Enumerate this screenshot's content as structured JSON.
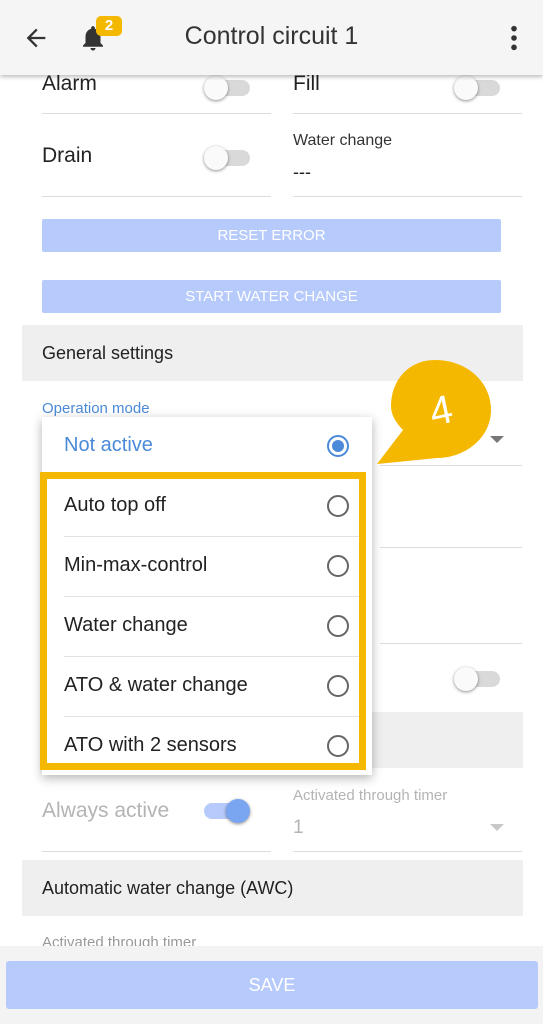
{
  "appbar": {
    "title": "Control circuit 1",
    "notification_count": "2"
  },
  "status": {
    "alarm_label": "Alarm",
    "fill_label": "Fill",
    "drain_label": "Drain",
    "water_change_label": "Water change",
    "water_change_value": "---"
  },
  "buttons": {
    "reset_error": "RESET ERROR",
    "start_water_change": "START WATER CHANGE",
    "save": "SAVE"
  },
  "general_settings": {
    "header": "General settings",
    "operation_mode_label": "Operation mode",
    "options": [
      {
        "label": "Not active",
        "selected": true
      },
      {
        "label": "Auto top off",
        "selected": false
      },
      {
        "label": "Min-max-control",
        "selected": false
      },
      {
        "label": "Water change",
        "selected": false
      },
      {
        "label": "ATO & water change",
        "selected": false
      },
      {
        "label": "ATO with 2 sensors",
        "selected": false
      }
    ]
  },
  "activation": {
    "always_active_label": "Always active",
    "timer_label": "Activated through timer",
    "timer_value": "1"
  },
  "awc": {
    "header": "Automatic water change (AWC)",
    "timer_label": "Activated through timer"
  },
  "callout": {
    "number": "4"
  },
  "colors": {
    "accent": "#4a8ad8",
    "highlight": "#f5b800",
    "button": "#b7cafc"
  }
}
